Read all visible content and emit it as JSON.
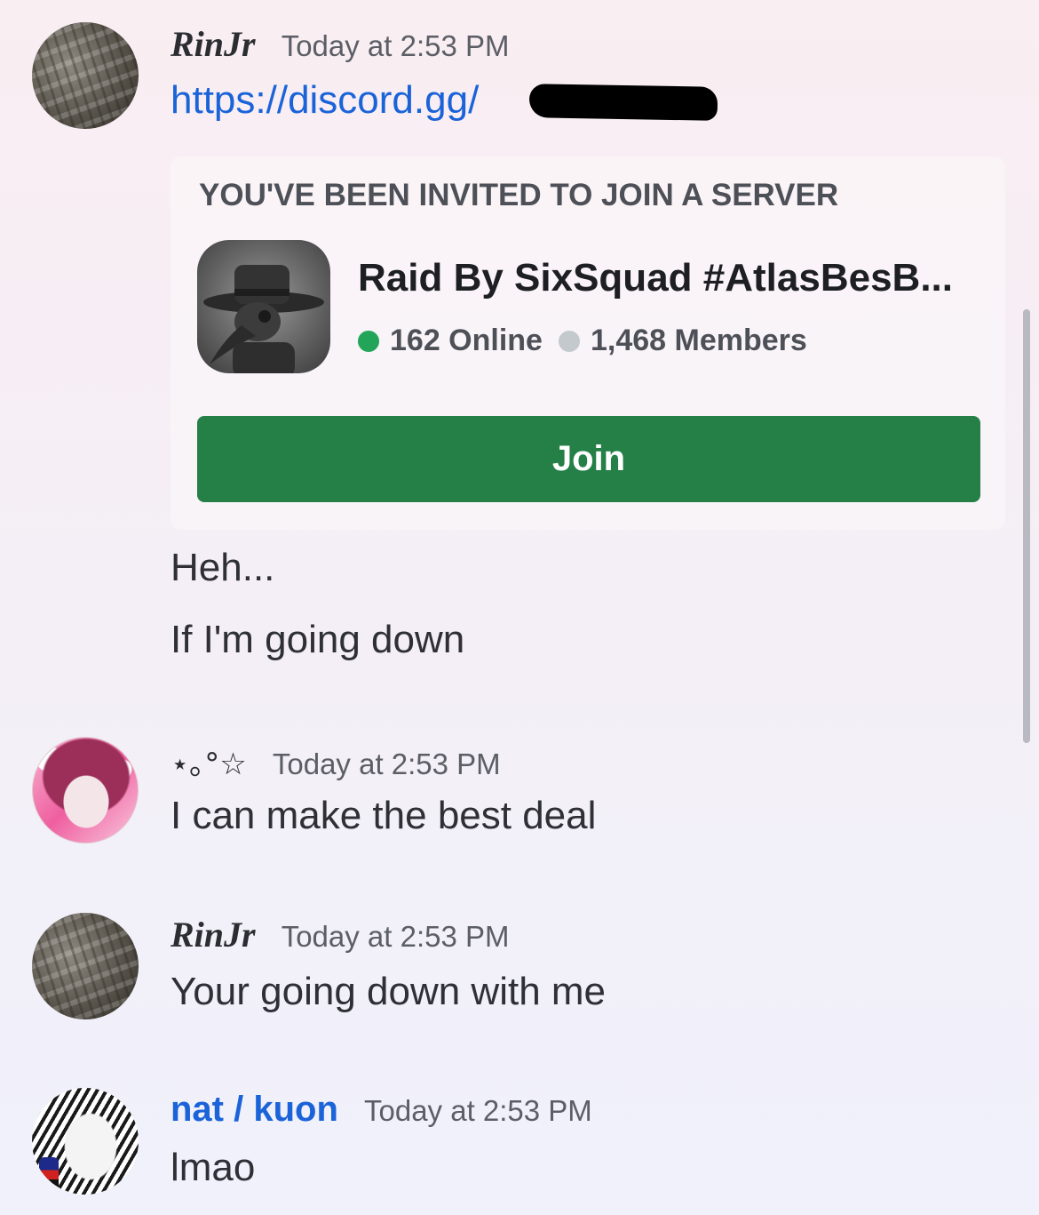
{
  "messages": [
    {
      "author": "RinJr",
      "timestamp": "Today at 2:53 PM",
      "link": "https://discord.gg/",
      "invite": {
        "title": "YOU'VE BEEN INVITED TO JOIN A SERVER",
        "server_name": "Raid By SixSquad #AtlasBesB...",
        "online": "162 Online",
        "members": "1,468 Members",
        "join_label": "Join",
        "colors": {
          "join": "#248046",
          "online_dot": "#23a559",
          "members_dot": "#c4c9ce"
        }
      },
      "lines": [
        "Heh...",
        "If I'm going down"
      ]
    },
    {
      "author": "⋆｡°☆",
      "timestamp": "Today at 2:53 PM",
      "lines": [
        "I can make the best deal"
      ]
    },
    {
      "author": "RinJr",
      "timestamp": "Today at 2:53 PM",
      "lines": [
        "Your going down with me"
      ]
    },
    {
      "author": "nat / kuon",
      "author_color": "#1a63d8",
      "timestamp": "Today at 2:53 PM",
      "lines": [
        "lmao"
      ]
    }
  ],
  "icons": {
    "avatar_1": "sand-footprints-avatar",
    "avatar_2": "anime-girl-avatar",
    "avatar_3": "sand-footprints-avatar",
    "avatar_4": "manga-avatar",
    "server_icon": "plague-doctor-icon"
  }
}
